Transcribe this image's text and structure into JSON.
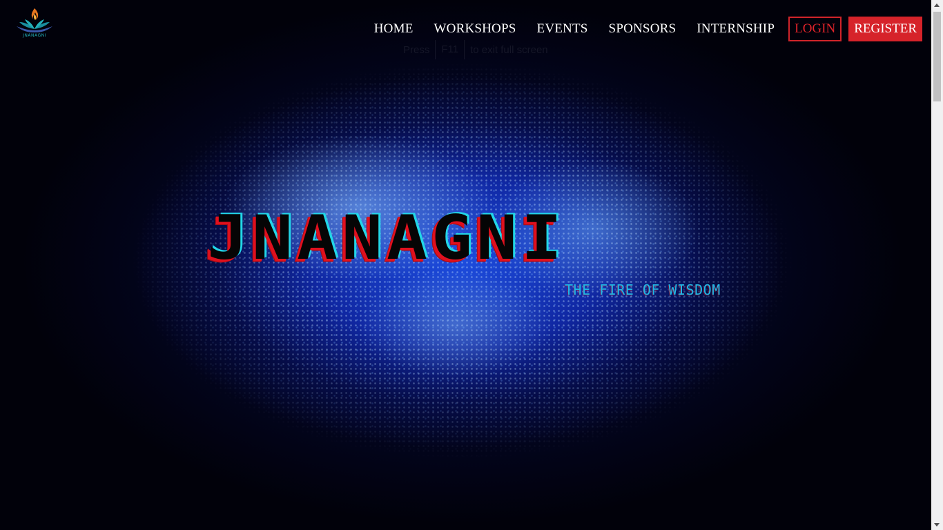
{
  "brand": {
    "logo_text": "JNANAGNI",
    "logo_icon": "flame-lotus-icon"
  },
  "nav": {
    "items": [
      {
        "label": "HOME"
      },
      {
        "label": "WORKSHOPS"
      },
      {
        "label": "EVENTS"
      },
      {
        "label": "SPONSORS"
      },
      {
        "label": "INTERNSHIP"
      }
    ],
    "login_label": "LOGIN",
    "register_label": "REGISTER"
  },
  "fullscreen_hint": {
    "prefix": "Press",
    "key": "F11",
    "suffix": "to exit full screen"
  },
  "hero": {
    "title": "JNANAGNI",
    "tagline": "THE FIRE OF WISDOM"
  },
  "colors": {
    "accent_red": "#d6232a",
    "tagline_cyan": "#1fb8e6",
    "background": "#01010a"
  }
}
